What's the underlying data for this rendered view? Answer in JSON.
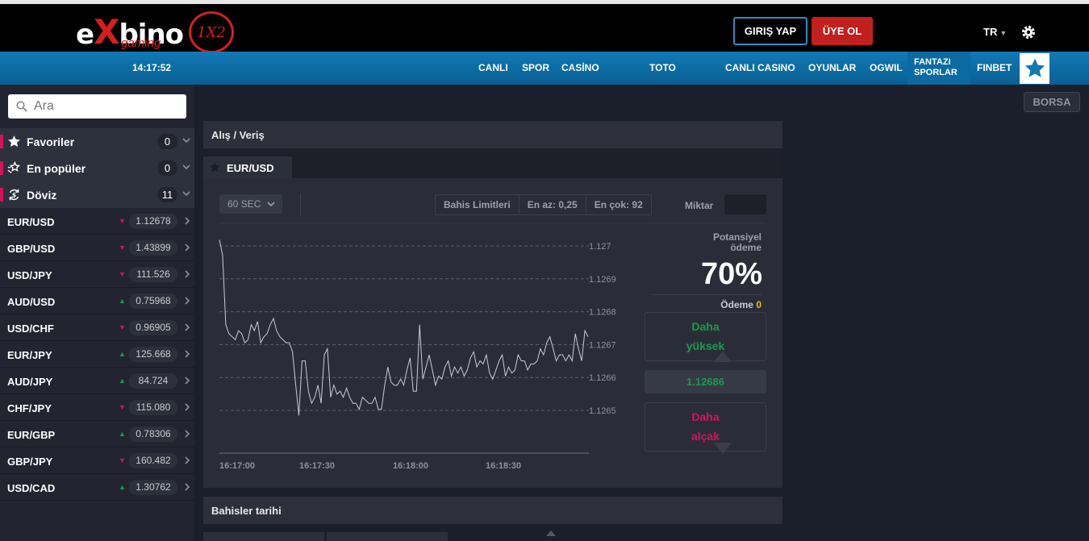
{
  "brand": {
    "name_left": "e",
    "name_x": "X",
    "name_right": "bino",
    "sub": "gaming",
    "badge": "1X2"
  },
  "header": {
    "login": "GIRIŞ YAP",
    "register": "ÜYE OL",
    "lang": "TR"
  },
  "nav": {
    "clock": "14:17:52",
    "items": [
      "CANLI",
      "SPOR",
      "CASİNO",
      "TOTO",
      "CANLI CASINO",
      "OYUNLAR",
      "OGWIL"
    ],
    "fantazi_line1": "FANTAZI",
    "fantazi_line2": "SPORLAR",
    "finbet": "FINBET"
  },
  "sidebar": {
    "search_placeholder": "Ara",
    "categories": [
      {
        "label": "Favoriler",
        "count": "0",
        "icon": "star-icon"
      },
      {
        "label": "En popüler",
        "count": "0",
        "icon": "popular-icon"
      },
      {
        "label": "Döviz",
        "count": "11",
        "icon": "currency-exchange-icon"
      }
    ],
    "pairs": [
      {
        "name": "EUR/USD",
        "value": "1.12678",
        "dir": "down"
      },
      {
        "name": "GBP/USD",
        "value": "1.43899",
        "dir": "down"
      },
      {
        "name": "USD/JPY",
        "value": "111.526",
        "dir": "down"
      },
      {
        "name": "AUD/USD",
        "value": "0.75968",
        "dir": "up"
      },
      {
        "name": "USD/CHF",
        "value": "0.96905",
        "dir": "down"
      },
      {
        "name": "EUR/JPY",
        "value": "125.668",
        "dir": "up"
      },
      {
        "name": "AUD/JPY",
        "value": "84.724",
        "dir": "up"
      },
      {
        "name": "CHF/JPY",
        "value": "115.080",
        "dir": "down"
      },
      {
        "name": "EUR/GBP",
        "value": "0.78306",
        "dir": "up"
      },
      {
        "name": "GBP/JPY",
        "value": "160.482",
        "dir": "down"
      },
      {
        "name": "USD/CAD",
        "value": "1.30762",
        "dir": "up"
      }
    ]
  },
  "main": {
    "borsa": "BORSA",
    "panel_title": "Alış / Veriş",
    "active_tab": "EUR/USD",
    "period": "60 SEC",
    "limits_label": "Bahis Limitleri",
    "min_label": "En az: 0,25",
    "max_label": "En çok: 92",
    "amount_label": "Miktar",
    "potential_line1": "Potansiyel",
    "potential_line2": "ödeme",
    "payout_pct": "70%",
    "payment_label": "Ödeme",
    "payment_value": "0",
    "higher_line1": "Daha",
    "higher_line2": "yüksek",
    "lower_line1": "Daha",
    "lower_line2": "alçak",
    "current_rate": "1.12686",
    "history_title": "Bahisler tarihi"
  },
  "chart_data": {
    "type": "line",
    "yticks": [
      "1.127",
      "1.1269",
      "1.1268",
      "1.1267",
      "1.1266",
      "1.1265"
    ],
    "xticks": [
      "16:17:00",
      "16:17:30",
      "16:18:00",
      "16:18:30"
    ],
    "ylim": [
      1.1265,
      1.1272
    ],
    "xlim": [
      0,
      116
    ],
    "grid": "horizontal-dashed",
    "series": [
      {
        "values": [
          1.12718,
          1.12713,
          1.1269,
          1.12687,
          1.12686,
          1.12685,
          1.12688,
          1.12687,
          1.12684,
          1.12685,
          1.1269,
          1.12688,
          1.12691,
          1.12684,
          1.12686,
          1.12687,
          1.1269,
          1.12692,
          1.12688,
          1.12686,
          1.12685,
          1.12684,
          1.12684,
          1.12681,
          1.1267,
          1.1266,
          1.12678,
          1.12678,
          1.12668,
          1.12664,
          1.12666,
          1.1267,
          1.12664,
          1.1268,
          1.12682,
          1.12666,
          1.1267,
          1.12667,
          1.12668,
          1.12666,
          1.12669,
          1.12666,
          1.12664,
          1.12664,
          1.12662,
          1.12666,
          1.12665,
          1.12664,
          1.12664,
          1.12666,
          1.12662,
          1.12662,
          1.1267,
          1.12676,
          1.12671,
          1.1267,
          1.1267,
          1.12672,
          1.1267,
          1.12675,
          1.12679,
          1.12668,
          1.12668,
          1.1269,
          1.12672,
          1.12676,
          1.1268,
          1.12675,
          1.1267,
          1.12673,
          1.12672,
          1.12676,
          1.12678,
          1.12673,
          1.12676,
          1.12674,
          1.12676,
          1.12673,
          1.12675,
          1.12679,
          1.12681,
          1.12676,
          1.12678,
          1.12677,
          1.1268,
          1.12674,
          1.12672,
          1.12675,
          1.12678,
          1.1268,
          1.12673,
          1.12676,
          1.12674,
          1.12675,
          1.1268,
          1.12678,
          1.12678,
          1.12675,
          1.12677,
          1.12677,
          1.12678,
          1.12682,
          1.1268,
          1.12684,
          1.12686,
          1.12682,
          1.12678,
          1.1268,
          1.1268,
          1.12678,
          1.1268,
          1.12678,
          1.12687,
          1.12682,
          1.12678,
          1.12688,
          1.12686
        ]
      }
    ]
  }
}
